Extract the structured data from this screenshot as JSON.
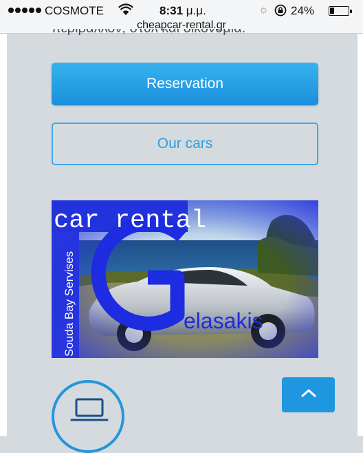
{
  "status_bar": {
    "carrier": "COSMOTE",
    "time": "8:31",
    "time_suffix": "μ.μ.",
    "battery": "24%",
    "battery_level": 0.24,
    "url": "cheapcar-rental.gr",
    "icons": [
      "signal-dots-icon",
      "wifi-icon",
      "brightness-icon",
      "rotation-lock-icon",
      "battery-icon"
    ]
  },
  "page": {
    "cut_off_text": "περιβάλλον, στυλ και οικονομία.",
    "reservation_label": "Reservation",
    "our_cars_label": "Our cars",
    "banner": {
      "title": "car rental",
      "side_text": "Souda Bay Servises",
      "logo_letter": "G",
      "logo_rest": "elasakis"
    },
    "scroll_top_icon": "chevron-up-icon",
    "feature_icon": "laptop-icon"
  },
  "colors": {
    "accent": "#1f97e0",
    "page_background": "#d4dade",
    "banner_blue": "#2233dd"
  }
}
